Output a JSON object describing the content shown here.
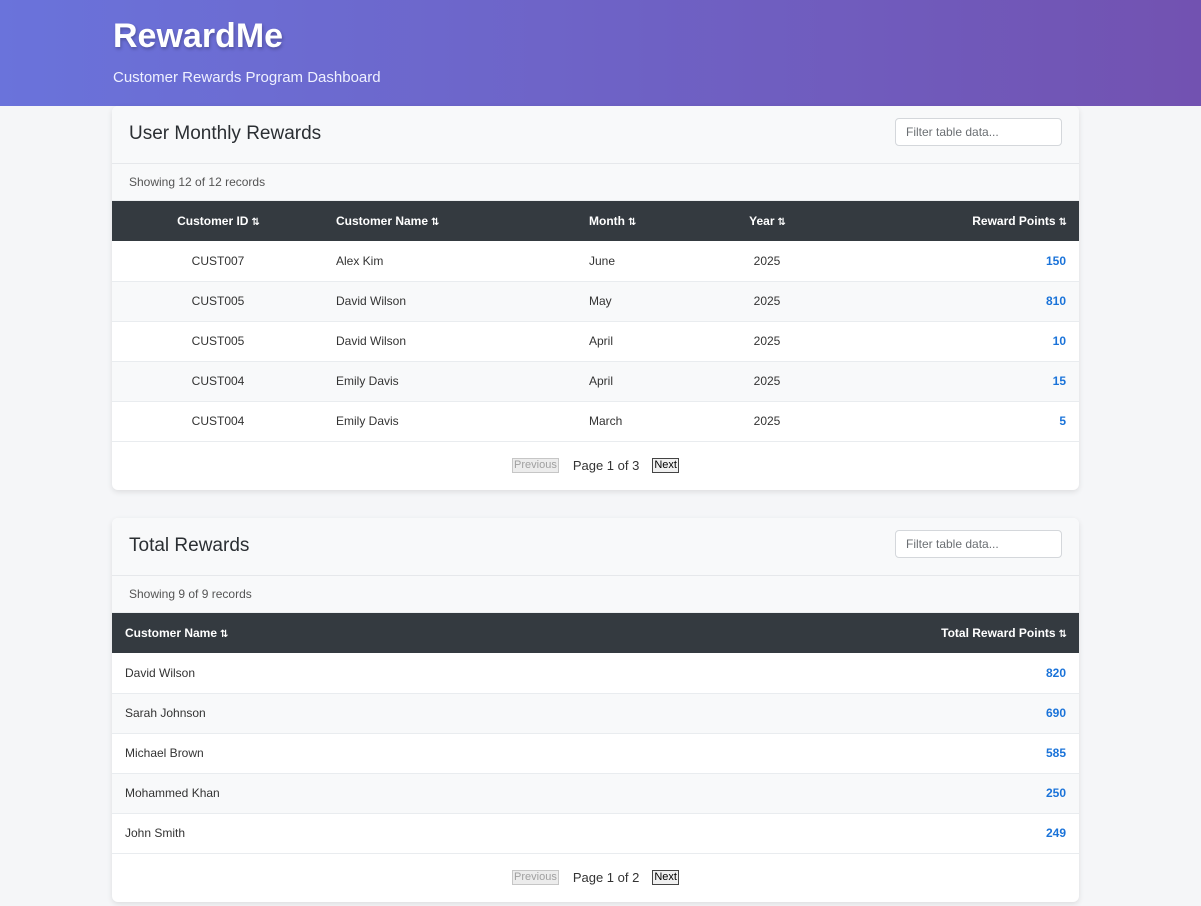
{
  "header": {
    "title": "RewardMe",
    "subtitle": "Customer Rewards Program Dashboard"
  },
  "monthly": {
    "title": "User Monthly Rewards",
    "filter_placeholder": "Filter table data...",
    "record_count": "Showing 12 of 12 records",
    "columns": [
      "Customer ID",
      "Customer Name",
      "Month",
      "Year",
      "Reward Points"
    ],
    "sort_icon": "⇅",
    "rows": [
      {
        "id": "CUST007",
        "name": "Alex Kim",
        "month": "June",
        "year": "2025",
        "points": "150"
      },
      {
        "id": "CUST005",
        "name": "David Wilson",
        "month": "May",
        "year": "2025",
        "points": "810"
      },
      {
        "id": "CUST005",
        "name": "David Wilson",
        "month": "April",
        "year": "2025",
        "points": "10"
      },
      {
        "id": "CUST004",
        "name": "Emily Davis",
        "month": "April",
        "year": "2025",
        "points": "15"
      },
      {
        "id": "CUST004",
        "name": "Emily Davis",
        "month": "March",
        "year": "2025",
        "points": "5"
      }
    ],
    "pager": {
      "previous": "Previous",
      "info": "Page 1 of 3",
      "next": "Next"
    }
  },
  "totals": {
    "title": "Total Rewards",
    "filter_placeholder": "Filter table data...",
    "record_count": "Showing 9 of 9 records",
    "columns": [
      "Customer Name",
      "Total Reward Points"
    ],
    "sort_icon": "⇅",
    "rows": [
      {
        "name": "David Wilson",
        "points": "820"
      },
      {
        "name": "Sarah Johnson",
        "points": "690"
      },
      {
        "name": "Michael Brown",
        "points": "585"
      },
      {
        "name": "Mohammed Khan",
        "points": "250"
      },
      {
        "name": "John Smith",
        "points": "249"
      }
    ],
    "pager": {
      "previous": "Previous",
      "info": "Page 1 of 2",
      "next": "Next"
    }
  },
  "colors": {
    "header_gradient_start": "#6a73db",
    "header_gradient_end": "#7252b1",
    "table_header_bg": "#343a40",
    "points_text": "#1a73d9"
  }
}
